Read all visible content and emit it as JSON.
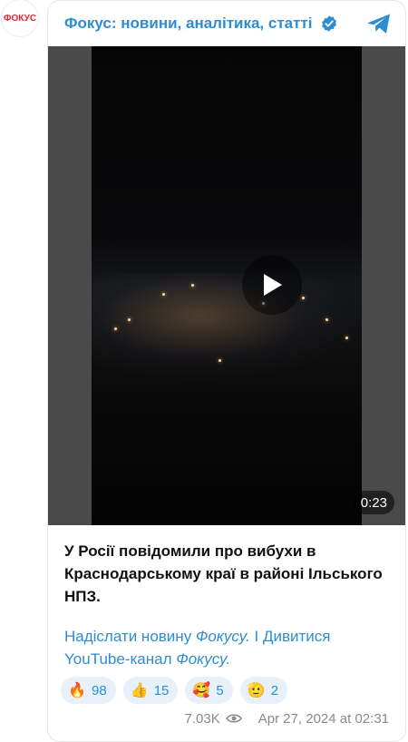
{
  "avatar": {
    "text": "ФОКУС"
  },
  "header": {
    "channel_name": "Фокус: новини, аналітика, статті",
    "verified_icon": "verified-badge-icon",
    "telegram_icon": "telegram-icon"
  },
  "video": {
    "duration": "0:23"
  },
  "post": {
    "text": "У Росії повідомили про вибухи в Краснодарському краї в районі Ільського НПЗ.",
    "links": {
      "part1": "Надіслати новину ",
      "part1_italic": "Фокусу.",
      "separator": " І ",
      "part2": "Дивитися YouTube-канал ",
      "part2_italic": "Фокусу."
    }
  },
  "reactions": [
    {
      "emoji": "🔥",
      "count": "98"
    },
    {
      "emoji": "👍",
      "count": "15"
    },
    {
      "emoji": "🥰",
      "count": "5"
    },
    {
      "emoji": "🫡",
      "count": "2"
    }
  ],
  "meta": {
    "views": "7.03K",
    "date": "Apr 27, 2024 at 02:31"
  },
  "colors": {
    "accent": "#2e8dd1",
    "brand_red": "#e3262e",
    "reaction_bg": "#e8f1fa"
  }
}
